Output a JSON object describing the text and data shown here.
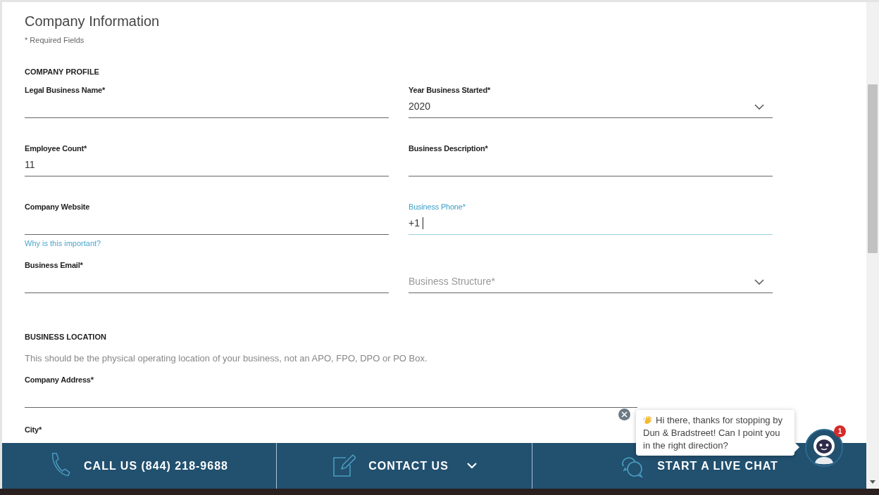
{
  "title": "Company Information",
  "required_note": "* Required Fields",
  "company_profile": {
    "heading": "COMPANY PROFILE",
    "fields": [
      {
        "label": "Legal Business Name*",
        "kind": "text",
        "focused": false
      },
      {
        "label": "Year Business Started*",
        "kind": "select",
        "value": "2020",
        "focused": false
      },
      {
        "label": "Employee Count*",
        "kind": "text",
        "value": "11",
        "focused": false
      },
      {
        "label": "Business Description*",
        "kind": "text",
        "focused": false
      },
      {
        "label": "Company Website",
        "kind": "text",
        "focused": false,
        "help_link": "Why is this important?"
      },
      {
        "label": "Business Phone*",
        "kind": "text",
        "value": "+1",
        "focused": true
      },
      {
        "label": "Business Email*",
        "kind": "text",
        "focused": false
      },
      {
        "kind": "select",
        "placeholder": "Business Structure*",
        "focused": false
      }
    ]
  },
  "business_location": {
    "heading": "BUSINESS LOCATION",
    "note": "This should be the physical operating location of your business, not an APO, FPO, DPO or PO Box.",
    "fields": [
      {
        "label": "Company Address*",
        "kind": "text",
        "focused": false
      },
      {
        "label": "City*",
        "kind": "cut"
      }
    ]
  },
  "footer_actions": [
    {
      "kind": "call",
      "label": "CALL US (844) 218-9688"
    },
    {
      "kind": "contact",
      "label": "CONTACT US"
    },
    {
      "kind": "chat",
      "label": "START A LIVE CHAT"
    }
  ],
  "chat_popup": {
    "message": "Hi there, thanks for stopping by Dun & Bradstreet! Can I point you in the right direction?",
    "badge": "1"
  }
}
